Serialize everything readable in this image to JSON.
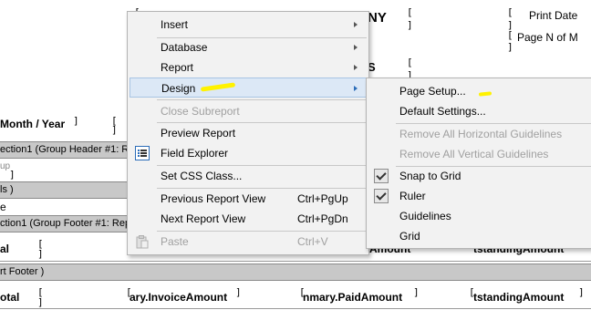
{
  "report": {
    "company": "NY",
    "print_date": "Print Date",
    "page_n_of_m": "Page N of M",
    "header_s": "S",
    "month_year": "Month / Year",
    "group_header_band": "ection1 (Group Header #1: Re",
    "group_placeholder": "up",
    "details_band": "ls )",
    "e_label": "e",
    "group_footer_band": "ction1 (Group Footer #1: Rep",
    "total_partial": "al",
    "paid_amount_partial": "Amount",
    "outstanding_partial": "tstandingAmount",
    "report_footer_band": "rt Footer )",
    "grand_total": "otal",
    "invoice_amount_field": "ary.InvoiceAmount",
    "paid_amount_field": "nmary.PaidAmount",
    "outstanding_amount_field": "tstandingAmount"
  },
  "context_menu": {
    "items": [
      {
        "label": "Insert",
        "submenu": true
      },
      {
        "label": "Database",
        "submenu": true
      },
      {
        "label": "Report",
        "submenu": true
      },
      {
        "label": "Design",
        "submenu": true
      },
      {
        "label": "Close Subreport",
        "disabled": true
      },
      {
        "label": "Preview Report"
      },
      {
        "label": "Field Explorer",
        "icon": "field-explorer-icon"
      },
      {
        "label": "Set CSS Class..."
      },
      {
        "label": "Previous Report View",
        "shortcut": "Ctrl+PgUp"
      },
      {
        "label": "Next Report View",
        "shortcut": "Ctrl+PgDn"
      },
      {
        "label": "Paste",
        "shortcut": "Ctrl+V",
        "disabled": true,
        "icon": "paste-icon"
      }
    ]
  },
  "design_submenu": {
    "items": [
      {
        "label": "Page Setup..."
      },
      {
        "label": "Default Settings..."
      },
      {
        "label": "Remove All Horizontal Guidelines",
        "disabled": true
      },
      {
        "label": "Remove All Vertical Guidelines",
        "disabled": true
      },
      {
        "label": "Snap to Grid",
        "checked": true
      },
      {
        "label": "Ruler",
        "checked": true
      },
      {
        "label": "Guidelines"
      },
      {
        "label": "Grid"
      }
    ]
  },
  "colors": {
    "highlight": "#fff200",
    "menu_hover": "#dce8f6",
    "band_gray": "#c8c8c8"
  }
}
